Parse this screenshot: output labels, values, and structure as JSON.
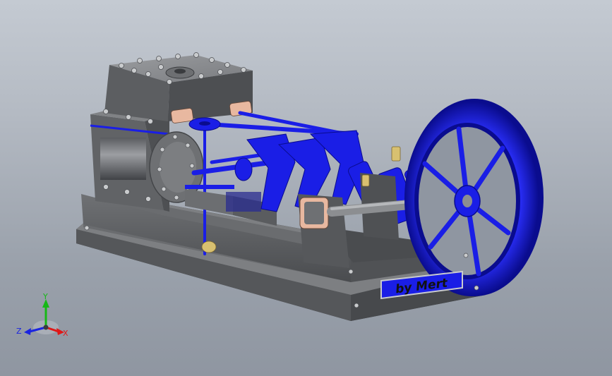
{
  "nameplate": {
    "text": "by Mert"
  },
  "triad": {
    "x_label": "X",
    "y_label": "Y",
    "z_label": "Z",
    "colors": {
      "x": "#e01818",
      "y": "#16b816",
      "z": "#1a24e0"
    }
  },
  "colors": {
    "background_top": "#c4cad2",
    "background_bottom": "#8f96a1",
    "cast_iron": "#5f6164",
    "cast_iron_light": "#8a8c8f",
    "paint_blue": "#1a1ee6",
    "paint_blue_dark": "#0a0c8e",
    "brass": "#d8c070",
    "copper_gasket": "#e8b8a0"
  }
}
